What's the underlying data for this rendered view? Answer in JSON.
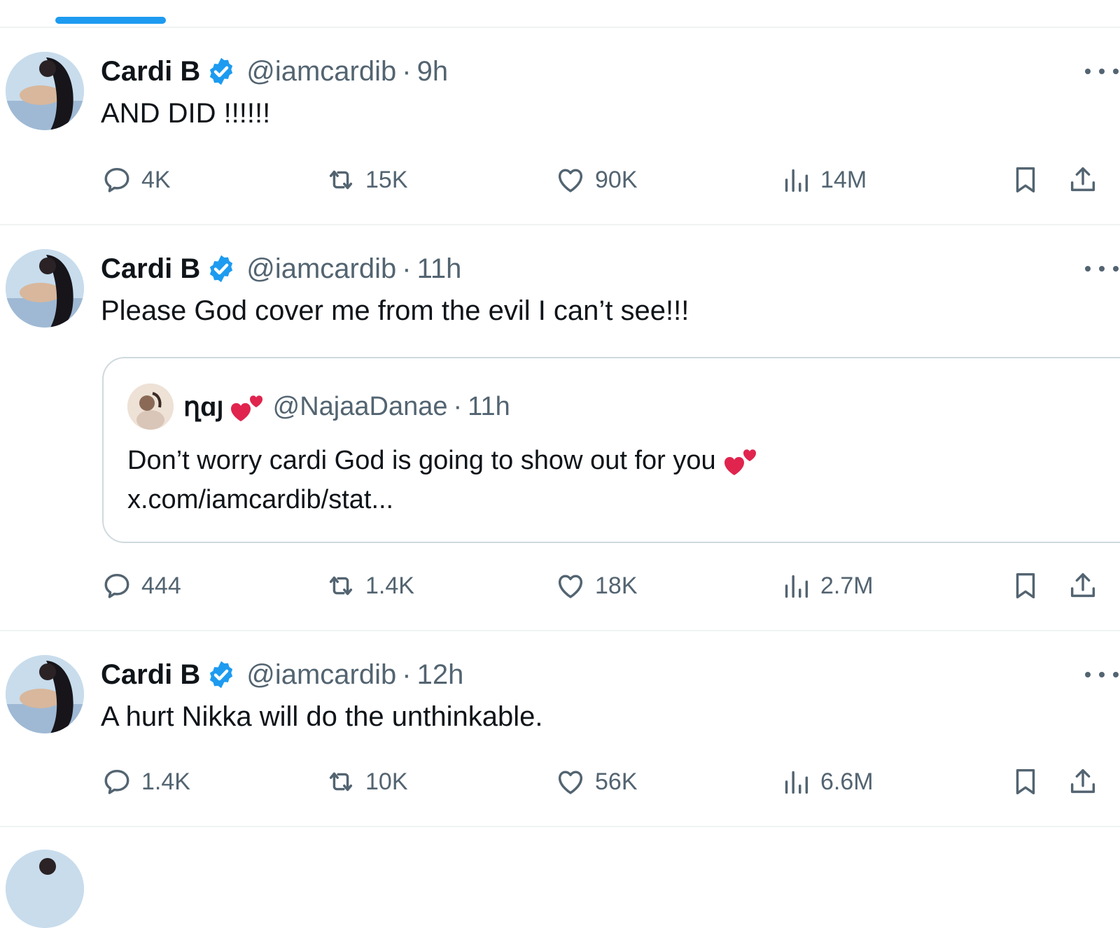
{
  "tweets": [
    {
      "name": "Cardi B",
      "handle": "@iamcardib",
      "sep": "·",
      "time": "9h",
      "text": "AND DID !!!!!!",
      "stats": {
        "replies": "4K",
        "retweets": "15K",
        "likes": "90K",
        "views": "14M"
      }
    },
    {
      "name": "Cardi B",
      "handle": "@iamcardib",
      "sep": "·",
      "time": "11h",
      "text": "Please God cover me from the evil I can’t see!!!",
      "quote": {
        "name": "ղɑյ",
        "handle": "@NajaaDanae",
        "sep": "·",
        "time": "11h",
        "text_line1": "Don’t worry cardi God is going to show out for you",
        "text_line2": "x.com/iamcardib/stat..."
      },
      "stats": {
        "replies": "444",
        "retweets": "1.4K",
        "likes": "18K",
        "views": "2.7M"
      }
    },
    {
      "name": "Cardi B",
      "handle": "@iamcardib",
      "sep": "·",
      "time": "12h",
      "text": "A hurt Nikka will do the unthinkable.",
      "stats": {
        "replies": "1.4K",
        "retweets": "10K",
        "likes": "56K",
        "views": "6.6M"
      }
    }
  ],
  "icons": {
    "reply": "reply-icon",
    "retweet": "retweet-icon",
    "like": "like-icon",
    "views": "views-icon",
    "bookmark": "bookmark-icon",
    "share": "share-icon",
    "verified": "verified-badge-icon",
    "more": "more-icon",
    "emoji": "two-hearts-emoji"
  },
  "colors": {
    "accent": "#1d9bf0",
    "muted": "#536471",
    "text": "#0f1419",
    "border": "#eff3f4",
    "heart_emoji": "#e0244e"
  }
}
